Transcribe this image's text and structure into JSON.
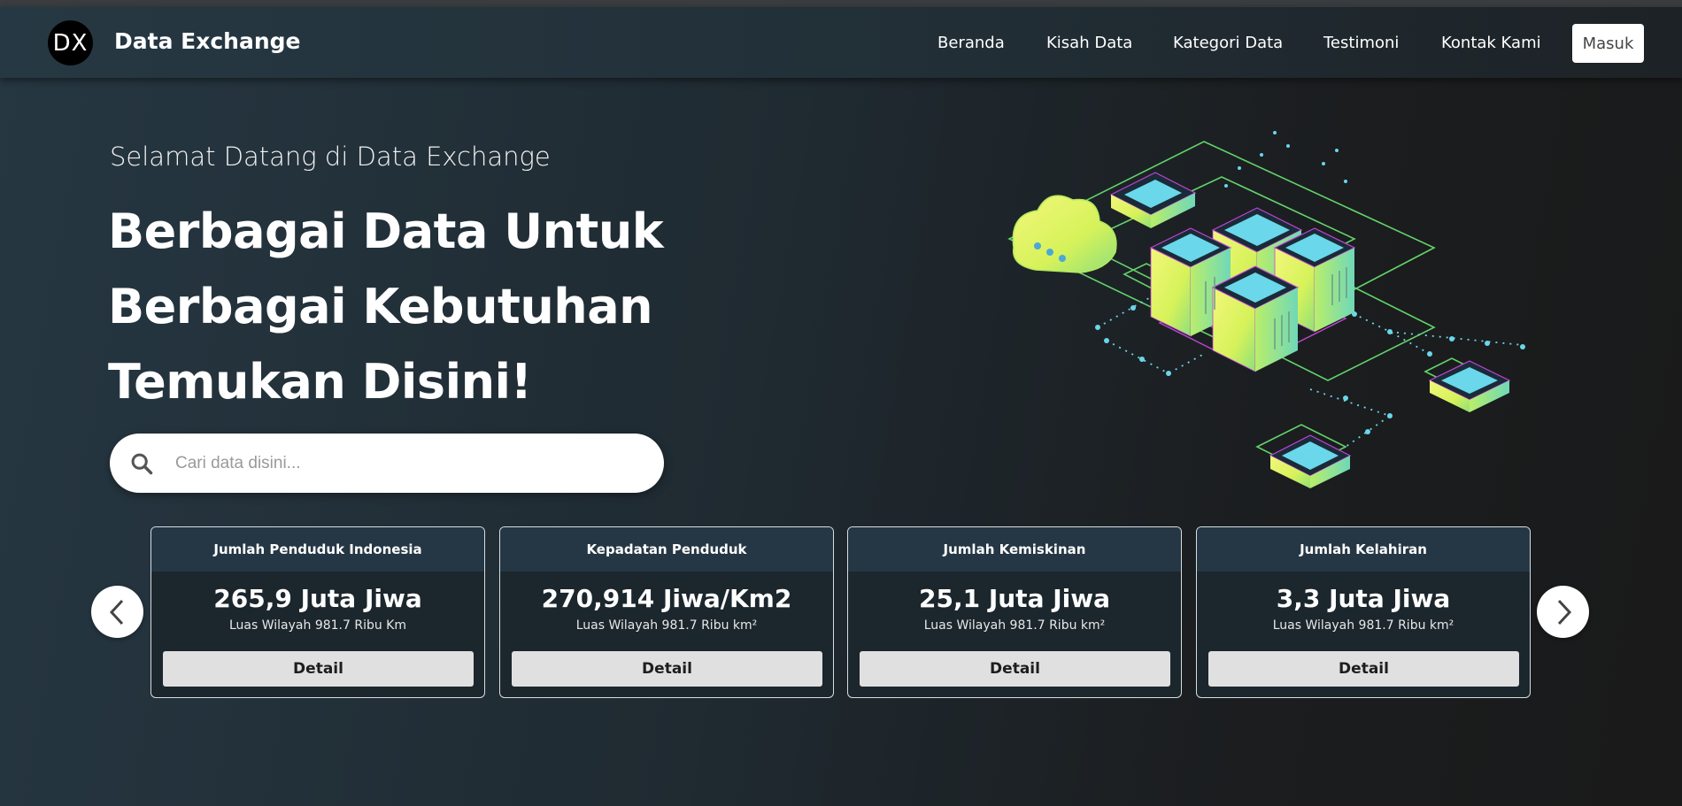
{
  "header": {
    "logo_text": "DX",
    "brand": "Data Exchange",
    "nav": [
      {
        "label": "Beranda"
      },
      {
        "label": "Kisah Data"
      },
      {
        "label": "Kategori Data"
      },
      {
        "label": "Testimoni"
      },
      {
        "label": "Kontak Kami"
      }
    ],
    "login_label": "Masuk"
  },
  "hero": {
    "welcome": "Selamat Datang di Data Exchange",
    "headline_lines": [
      "Berbagai Data Untuk",
      "Berbagai Kebutuhan",
      "Temukan Disini!"
    ],
    "search_placeholder": "Cari data disini..."
  },
  "stats": [
    {
      "title": "Jumlah Penduduk Indonesia",
      "value": "265,9 Juta Jiwa",
      "sub": "Luas Wilayah 981.7 Ribu Km",
      "button": "Detail"
    },
    {
      "title": "Kepadatan Penduduk",
      "value": "270,914 Jiwa/Km2",
      "sub": "Luas Wilayah 981.7 Ribu km²",
      "button": "Detail"
    },
    {
      "title": "Jumlah Kemiskinan",
      "value": "25,1 Juta Jiwa",
      "sub": "Luas Wilayah 981.7 Ribu km²",
      "button": "Detail"
    },
    {
      "title": "Jumlah Kelahiran",
      "value": "3,3 Juta Jiwa",
      "sub": "Luas Wilayah 981.7 Ribu km²",
      "button": "Detail"
    }
  ],
  "icons": {
    "search": "search-icon",
    "prev": "chevron-left-icon",
    "next": "chevron-right-icon"
  },
  "colors": {
    "background": "#1f2a31",
    "card_header": "#253745",
    "accent_green": "#7ee36a",
    "accent_cyan": "#6ad7ea",
    "accent_yellow": "#e9f46a"
  }
}
